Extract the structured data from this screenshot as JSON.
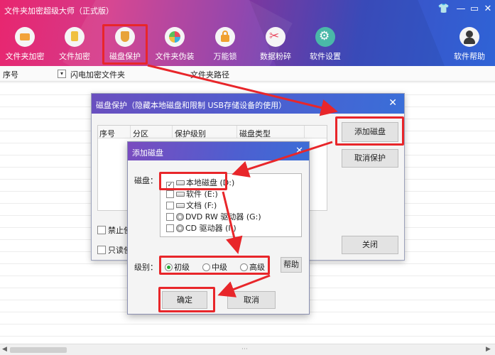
{
  "window": {
    "title": "文件夹加密超级大师（正式版）",
    "controls": {
      "skin": "👕",
      "min": "—",
      "max": "▭",
      "close": "✕"
    }
  },
  "toolbar": {
    "items": [
      {
        "label": "文件夹加密",
        "icon": "folder-icon",
        "color": "#f2a33a"
      },
      {
        "label": "文件加密",
        "icon": "file-lock-icon",
        "color": "#f0c040"
      },
      {
        "label": "磁盘保护",
        "icon": "shield-icon",
        "color": "#e8a33a",
        "active": true
      },
      {
        "label": "文件夹伪装",
        "icon": "palette-icon",
        "color": "#f0f0f0"
      },
      {
        "label": "万能锁",
        "icon": "lock-icon",
        "color": "#f0c040"
      },
      {
        "label": "数据粉碎",
        "icon": "scissors-icon",
        "color": "#e84a60"
      },
      {
        "label": "软件设置",
        "icon": "gear-icon",
        "color": "#4ab8a8"
      },
      {
        "label": "软件帮助",
        "icon": "help-user-icon",
        "color": "#3a3a3a"
      }
    ]
  },
  "main_list": {
    "columns": [
      "序号",
      "闪电加密文件夹",
      "文件夹路径"
    ]
  },
  "disk_dialog": {
    "title": "磁盘保护（隐藏本地磁盘和限制 USB存储设备的使用）",
    "columns": [
      "序号",
      "分区",
      "保护级别",
      "磁盘类型"
    ],
    "option1": "禁止使",
    "option2": "只读使",
    "buttons": {
      "add": "添加磁盘",
      "cancel_protect": "取消保护",
      "close": "关闭"
    }
  },
  "add_dialog": {
    "title": "添加磁盘",
    "disk_label": "磁盘：",
    "disks": [
      {
        "label": "本地磁盘 (D:)",
        "checked": true,
        "type": "hdd"
      },
      {
        "label": "软件 (E:)",
        "checked": false,
        "type": "hdd"
      },
      {
        "label": "文档 (F:)",
        "checked": false,
        "type": "hdd"
      },
      {
        "label": "DVD RW 驱动器 (G:)",
        "checked": false,
        "type": "cd"
      },
      {
        "label": "CD 驱动器 (I:)",
        "checked": false,
        "type": "cd"
      }
    ],
    "level_label": "级别：",
    "levels": [
      {
        "label": "初级",
        "selected": true
      },
      {
        "label": "中级",
        "selected": false
      },
      {
        "label": "高级",
        "selected": false
      }
    ],
    "help": "帮助",
    "ok": "确定",
    "cancel": "取消"
  },
  "colors": {
    "annotation": "#e8262a",
    "accent_green": "#22aa33"
  }
}
